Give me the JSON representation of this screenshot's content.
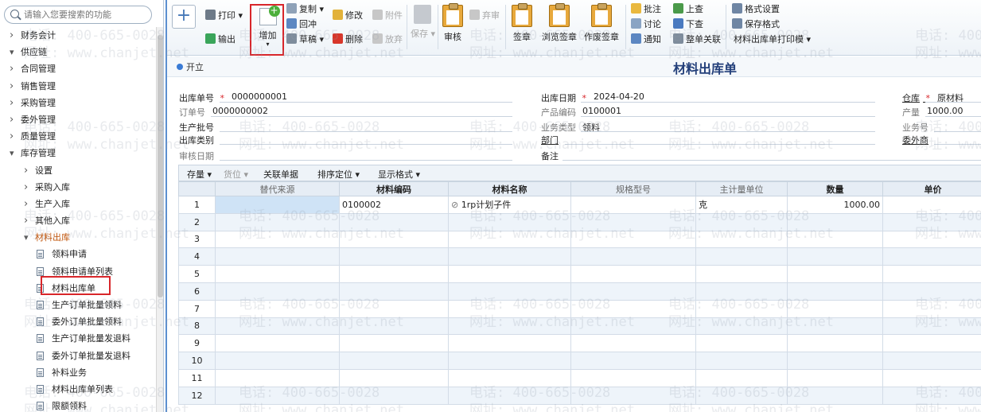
{
  "sidebar": {
    "search_placeholder": "请输入您要搜索的功能",
    "items": [
      {
        "label": "财务会计",
        "level": 0,
        "state": "collapsed"
      },
      {
        "label": "供应链",
        "level": 0,
        "state": "expanded"
      },
      {
        "label": "合同管理",
        "level": 1,
        "state": "collapsed"
      },
      {
        "label": "销售管理",
        "level": 1,
        "state": "collapsed"
      },
      {
        "label": "采购管理",
        "level": 1,
        "state": "collapsed"
      },
      {
        "label": "委外管理",
        "level": 1,
        "state": "collapsed"
      },
      {
        "label": "质量管理",
        "level": 1,
        "state": "collapsed"
      },
      {
        "label": "库存管理",
        "level": 1,
        "state": "expanded"
      },
      {
        "label": "设置",
        "level": 2,
        "state": "collapsed"
      },
      {
        "label": "采购入库",
        "level": 2,
        "state": "collapsed"
      },
      {
        "label": "生产入库",
        "level": 2,
        "state": "collapsed"
      },
      {
        "label": "其他入库",
        "level": 2,
        "state": "collapsed"
      },
      {
        "label": "材料出库",
        "level": 2,
        "state": "expanded"
      },
      {
        "label": "领料申请",
        "level": 3,
        "state": "leaf"
      },
      {
        "label": "领料申请单列表",
        "level": 3,
        "state": "leaf"
      },
      {
        "label": "材料出库单",
        "level": 3,
        "state": "leaf"
      },
      {
        "label": "生产订单批量领料",
        "level": 3,
        "state": "leaf"
      },
      {
        "label": "委外订单批量领料",
        "level": 3,
        "state": "leaf"
      },
      {
        "label": "生产订单批量发退料",
        "level": 3,
        "state": "leaf"
      },
      {
        "label": "委外订单批量发退料",
        "level": 3,
        "state": "leaf"
      },
      {
        "label": "补料业务",
        "level": 3,
        "state": "leaf"
      },
      {
        "label": "材料出库单列表",
        "level": 3,
        "state": "leaf"
      },
      {
        "label": "限额领料",
        "level": 3,
        "state": "leaf"
      }
    ]
  },
  "toolbar": {
    "print": "打印",
    "export": "输出",
    "add": "增加",
    "copy": "复制",
    "revert": "回冲",
    "draft": "草稿",
    "modify": "修改",
    "delete": "删除",
    "attach": "附件",
    "abandon": "放弃",
    "save": "保存",
    "audit": "审核",
    "unaudit": "弃审",
    "sign": "签章",
    "browse_sign": "浏览签章",
    "void_sign": "作废签章",
    "annotate": "批注",
    "discuss": "讨论",
    "notify": "通知",
    "prev_query": "上查",
    "next_query": "下查",
    "whole_link": "整单关联",
    "format_settings": "格式设置",
    "save_format": "保存格式",
    "print_template": "材料出库单打印模"
  },
  "status": {
    "text": "开立"
  },
  "form": {
    "title": "材料出库单",
    "fields": {
      "out_no": {
        "label": "出库单号",
        "value": "0000000001"
      },
      "order_no": {
        "label": "订单号",
        "value": "0000000002"
      },
      "batch_no": {
        "label": "生产批号",
        "value": ""
      },
      "out_category": {
        "label": "出库类别",
        "value": ""
      },
      "audit_date": {
        "label": "审核日期",
        "value": ""
      },
      "out_date": {
        "label": "出库日期",
        "value": "2024-04-20"
      },
      "product_code": {
        "label": "产品编码",
        "value": "0100001"
      },
      "biz_type": {
        "label": "业务类型",
        "value": "领料"
      },
      "department": {
        "label": "部门",
        "value": ""
      },
      "remark": {
        "label": "备注",
        "value": ""
      },
      "warehouse": {
        "label": "仓库",
        "value": "原材料"
      },
      "output": {
        "label": "产量",
        "value": "1000.00"
      },
      "biz_no": {
        "label": "业务号",
        "value": ""
      },
      "outsource": {
        "label": "委外商",
        "value": ""
      }
    }
  },
  "grid_toolbar": {
    "stock": "存量",
    "location": "货位",
    "linked_docs": "关联单据",
    "sort_locate": "排序定位",
    "display_format": "显示格式"
  },
  "grid": {
    "columns": [
      "替代来源",
      "材料编码",
      "材料名称",
      "规格型号",
      "主计量单位",
      "数量",
      "单价"
    ],
    "rows": [
      {
        "no": "1",
        "cells": [
          "",
          "0100002",
          "1rp计划子件",
          "",
          "克",
          "1000.00",
          ""
        ]
      },
      {
        "no": "2",
        "cells": [
          "",
          "",
          "",
          "",
          "",
          "",
          ""
        ]
      },
      {
        "no": "3",
        "cells": [
          "",
          "",
          "",
          "",
          "",
          "",
          ""
        ]
      },
      {
        "no": "4",
        "cells": [
          "",
          "",
          "",
          "",
          "",
          "",
          ""
        ]
      },
      {
        "no": "5",
        "cells": [
          "",
          "",
          "",
          "",
          "",
          "",
          ""
        ]
      },
      {
        "no": "6",
        "cells": [
          "",
          "",
          "",
          "",
          "",
          "",
          ""
        ]
      },
      {
        "no": "7",
        "cells": [
          "",
          "",
          "",
          "",
          "",
          "",
          ""
        ]
      },
      {
        "no": "8",
        "cells": [
          "",
          "",
          "",
          "",
          "",
          "",
          ""
        ]
      },
      {
        "no": "9",
        "cells": [
          "",
          "",
          "",
          "",
          "",
          "",
          ""
        ]
      },
      {
        "no": "10",
        "cells": [
          "",
          "",
          "",
          "",
          "",
          "",
          ""
        ]
      },
      {
        "no": "11",
        "cells": [
          "",
          "",
          "",
          "",
          "",
          "",
          ""
        ]
      },
      {
        "no": "12",
        "cells": [
          "",
          "",
          "",
          "",
          "",
          "",
          ""
        ]
      }
    ]
  },
  "watermark": {
    "phone": "电话: 400-665-0028",
    "site": "网址: www.chanjet.net"
  },
  "colors": {
    "accent": "#3a7bd5",
    "highlight_red": "#d8262a",
    "title": "#233f7a",
    "open_node": "#c0540a"
  }
}
